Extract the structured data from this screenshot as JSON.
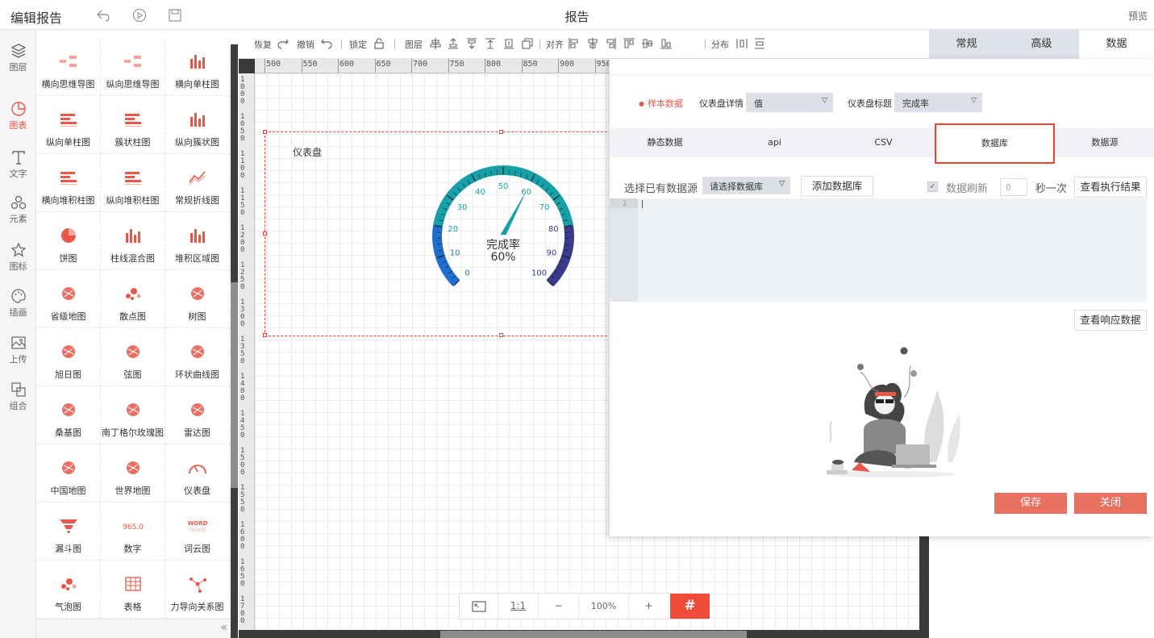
{
  "topbar": {
    "title": "编辑报告",
    "center_title": "报告",
    "preview_label": "预览"
  },
  "rail": [
    {
      "label": "图层",
      "icon": "layers-icon"
    },
    {
      "label": "图表",
      "icon": "chart-pie-icon",
      "active": true
    },
    {
      "label": "文字",
      "icon": "text-icon"
    },
    {
      "label": "元素",
      "icon": "shapes-icon"
    },
    {
      "label": "图标",
      "icon": "star-icon"
    },
    {
      "label": "插画",
      "icon": "palette-icon"
    },
    {
      "label": "上传",
      "icon": "image-upload-icon"
    },
    {
      "label": "组合",
      "icon": "group-icon"
    }
  ],
  "palette": [
    "横向思维导图",
    "纵向思维导图",
    "横向单柱图",
    "纵向单柱图",
    "簇状柱图",
    "纵向簇状图",
    "横向堆积柱图",
    "纵向堆积柱图",
    "常规折线图",
    "饼图",
    "柱线混合图",
    "堆积区域图",
    "省级地图",
    "散点图",
    "树图",
    "旭日图",
    "弦图",
    "环状曲线图",
    "桑基图",
    "南丁格尔玫瑰图",
    "雷达图",
    "中国地图",
    "世界地图",
    "仪表盘",
    "漏斗图",
    "数字",
    "词云图",
    "气泡图",
    "表格",
    "力导向关系图"
  ],
  "palette_collapse": "«",
  "toolbar": {
    "redo": "恢复",
    "undo": "撤销",
    "lock": "锁定",
    "layer": "图层",
    "align": "对齐",
    "distribute": "分布"
  },
  "ruler": {
    "top": [
      "500",
      "550",
      "600",
      "650",
      "700",
      "750",
      "800",
      "850",
      "900",
      "950"
    ],
    "left": [
      "1000",
      "1050",
      "1100",
      "1150",
      "1200",
      "1250",
      "1300",
      "1350",
      "1400",
      "1450",
      "1500",
      "1550",
      "1600",
      "1650",
      "1700"
    ]
  },
  "widget": {
    "title": "仪表盘",
    "gauge": {
      "label": "完成率",
      "value": 60,
      "value_text": "60%",
      "min": 0,
      "max": 100,
      "ticks": [
        "0",
        "10",
        "20",
        "30",
        "40",
        "50",
        "60",
        "70",
        "80",
        "90",
        "100"
      ],
      "colors": {
        "low": "#1f6fd0",
        "mid": "#18a0a8",
        "high": "#3a3a8c"
      }
    }
  },
  "zoom": {
    "fit": "⤢",
    "one_to_one": "1:1",
    "minus": "−",
    "level": "100%",
    "plus": "+",
    "grid": "#"
  },
  "right_tabs": [
    {
      "label": "常规"
    },
    {
      "label": "高级"
    },
    {
      "label": "数据",
      "active": true
    }
  ],
  "modal": {
    "sample_data": "样本数据",
    "gauge_detail_label": "仪表盘详情",
    "gauge_detail_value": "值",
    "gauge_title_label": "仪表盘标题",
    "gauge_title_value": "完成率",
    "tabs": [
      "静态数据",
      "api",
      "CSV",
      "数据库",
      "数据源"
    ],
    "active_tab": "数据库",
    "choose_source_label": "选择已有数据源",
    "choose_db_placeholder": "请选择数据库",
    "add_db_button": "添加数据库",
    "refresh_checkbox": "✓",
    "refresh_label": "数据刷新",
    "refresh_value": "0",
    "per_second": "秒一次",
    "view_exec_button": "查看执行结果",
    "line_number": "1",
    "view_response_button": "查看响应数据",
    "save_button": "保存",
    "close_button": "关闭",
    "accent_color": "#e8584a"
  }
}
